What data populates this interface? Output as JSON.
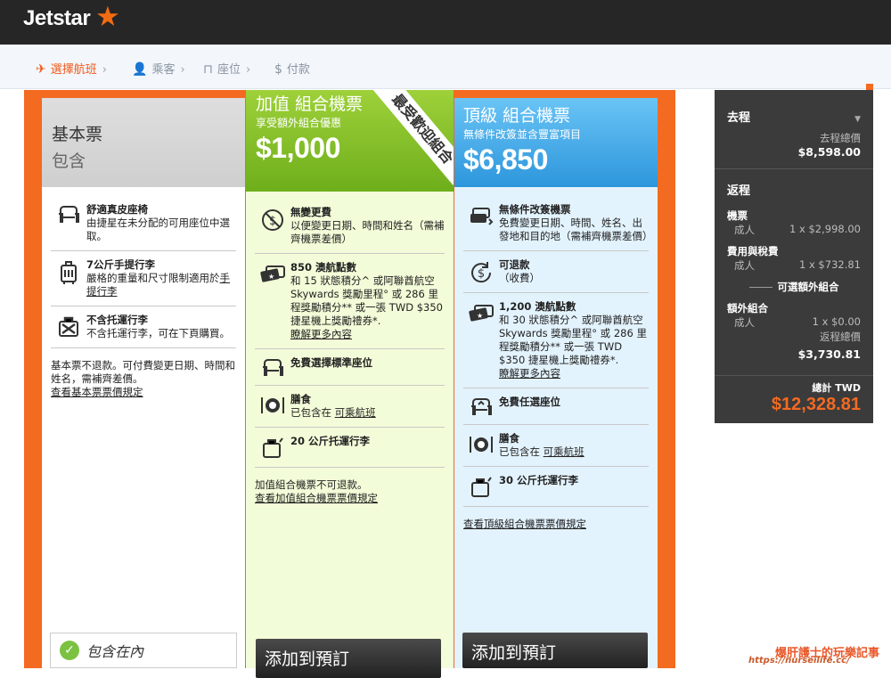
{
  "header": {
    "logo": "Jetstar"
  },
  "stepper": {
    "steps": [
      {
        "label": "選擇航班",
        "active": true
      },
      {
        "label": "乘客",
        "active": false
      },
      {
        "label": "座位",
        "active": false
      },
      {
        "label": "付款",
        "active": false
      }
    ]
  },
  "basic": {
    "title": "基本票",
    "subtitle": "包含",
    "features": [
      {
        "title": "舒適真皮座椅",
        "text": "由捷星在未分配的可用座位中選取。",
        "icon": "seat-icon"
      },
      {
        "title": "7公斤手提行李",
        "text": "嚴格的重量和尺寸限制適用於",
        "link": "手提行李",
        "icon": "carry-on-bag-icon"
      },
      {
        "title": "不含托運行李",
        "text": "不含托運行李，可在下頁購買。",
        "icon": "no-checked-bag-icon"
      }
    ],
    "note": "基本票不退款。可付費變更日期、時間和姓名，需補齊差價。",
    "note_link": "查看基本票票價規定",
    "included_label": "包含在內"
  },
  "plus": {
    "title": "加值 組合機票",
    "desc": "享受額外組合優惠",
    "price": "$1,000",
    "ribbon": "最受歡迎組合",
    "features": [
      {
        "title": "無變更費",
        "text": "以便變更日期、時間和姓名（需補齊機票差價）",
        "icon": "no-fee-icon"
      },
      {
        "title": "850 澳航點數",
        "text": "和 15 狀態積分^ 或阿聯酋航空 Skywards 獎勵里程° 或 286 里程獎勵積分** 或一張 TWD $350 捷星機上獎勵禮券*.",
        "link": "瞭解更多內容",
        "icon": "voucher-icon"
      },
      {
        "title": "免費選擇標準座位",
        "text": "",
        "icon": "seat-icon"
      },
      {
        "title": "膳食",
        "text": "已包含在",
        "link": "可乘航班",
        "icon": "meal-icon"
      },
      {
        "title": "20 公斤托運行李",
        "text": "",
        "icon": "checked-bag-icon"
      }
    ],
    "note": "加值組合機票不可退款。",
    "note_link": "查看加值組合機票票價規定",
    "add_label": "添加到預訂"
  },
  "max": {
    "title": "頂級 組合機票",
    "desc": "無條件改簽並含豐富項目",
    "price": "$6,850",
    "features": [
      {
        "title": "無條件改簽機票",
        "text": "免費變更日期、時間、姓名、出發地和目的地（需補齊機票差價）",
        "icon": "change-ticket-icon"
      },
      {
        "title": "可退款",
        "text": "（收費）",
        "icon": "refund-icon"
      },
      {
        "title": "1,200 澳航點數",
        "text": "和 30 狀態積分^ 或阿聯酋航空 Skywards 獎勵里程° 或 286 里程獎勵積分** 或一張 TWD $350 捷星機上獎勵禮券*.",
        "link": "瞭解更多內容",
        "icon": "voucher-icon"
      },
      {
        "title": "免費任選座位",
        "text": "",
        "icon": "seat-icon"
      },
      {
        "title": "膳食",
        "text": "已包含在",
        "link": "可乘航班",
        "icon": "meal-icon"
      },
      {
        "title": "30 公斤托運行李",
        "text": "",
        "icon": "checked-bag-icon"
      }
    ],
    "note_link": "查看頂級組合機票票價規定",
    "add_label": "添加到預訂"
  },
  "summary": {
    "outbound": {
      "title": "去程",
      "total_label": "去程總價",
      "total": "$8,598.00"
    },
    "return": {
      "title": "返程",
      "fare_label": "機票",
      "fare_pax": "成人",
      "fare_value": "1 x $2,998.00",
      "tax_label": "費用與稅費",
      "tax_pax": "成人",
      "tax_value": "1 x $732.81",
      "addons_heading": "可選額外組合",
      "addon_label": "額外組合",
      "addon_pax": "成人",
      "addon_value": "1 x $0.00",
      "total_label": "返程總價",
      "total": "$3,730.81"
    },
    "grand_total_label": "總計 TWD",
    "grand_total": "$12,328.81"
  },
  "watermark": {
    "line1": "爆肝護士的玩樂記事",
    "line2": "https://nurseilife.cc/"
  },
  "colors": {
    "brand_orange": "#f36a21",
    "plus_green": "#8cc43a",
    "max_blue": "#3aa3e3",
    "dark": "#262626"
  }
}
